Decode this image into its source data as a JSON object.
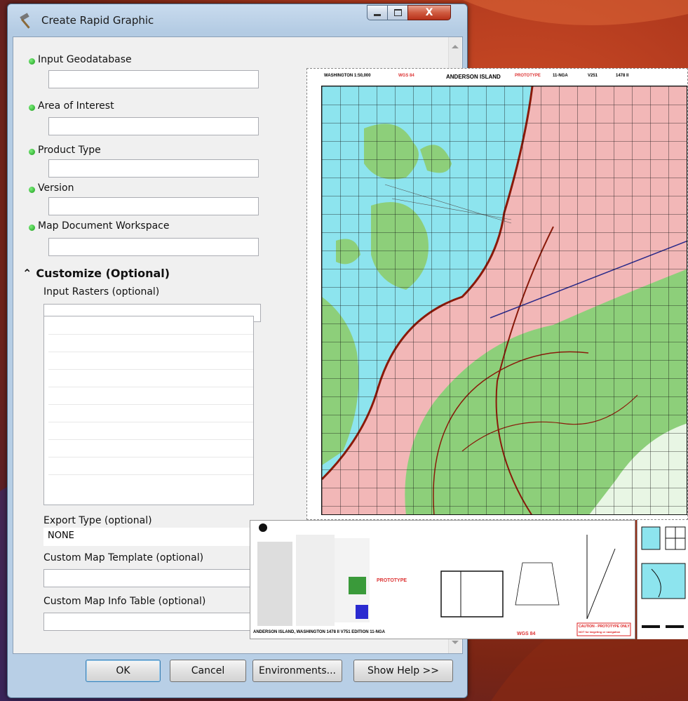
{
  "window": {
    "title": "Create Rapid Graphic",
    "close_glyph": "X"
  },
  "params": [
    {
      "label": "Input Geodatabase",
      "required": true,
      "value": ""
    },
    {
      "label": "Area of Interest",
      "required": true,
      "value": ""
    },
    {
      "label": "Product Type",
      "required": true,
      "value": ""
    },
    {
      "label": "Version",
      "required": true,
      "value": ""
    },
    {
      "label": "Map Document Workspace",
      "required": true,
      "value": ""
    }
  ],
  "customize": {
    "chevron": "⌃",
    "title": "Customize (Optional)",
    "input_rasters_label": "Input Rasters (optional)",
    "export_type_label": "Export Type (optional)",
    "export_type_value": "NONE",
    "custom_template_label": "Custom Map Template (optional)",
    "custom_info_label": "Custom Map Info Table (optional)"
  },
  "buttons": {
    "ok": "OK",
    "cancel": "Cancel",
    "environments": "Environments...",
    "help": "Show Help >>"
  },
  "map": {
    "header_left": "WASHINGTON 1:50,000",
    "header_datum": "WGS 84",
    "header_title": "ANDERSON ISLAND",
    "header_prototype": "PROTOTYPE",
    "header_edition": "11-NGA",
    "header_version": "V251",
    "header_sheet": "1478 II",
    "margin_prototype": "PROTOTYPE",
    "footer": "ANDERSON ISLAND, WASHINGTON   1478 II   V751   EDITION 11-NGA",
    "footer_datum": "WGS 84",
    "caution": "CAUTION - PROTOTYPE ONLY",
    "caution_sub": "NOT for targeting or navigation"
  },
  "colors": {
    "water": "#8de4ee",
    "land_green": "#8dcf7a",
    "urban": "#f2b7b7",
    "contour": "#8a1a0a",
    "accent": "#3c7fb1"
  }
}
